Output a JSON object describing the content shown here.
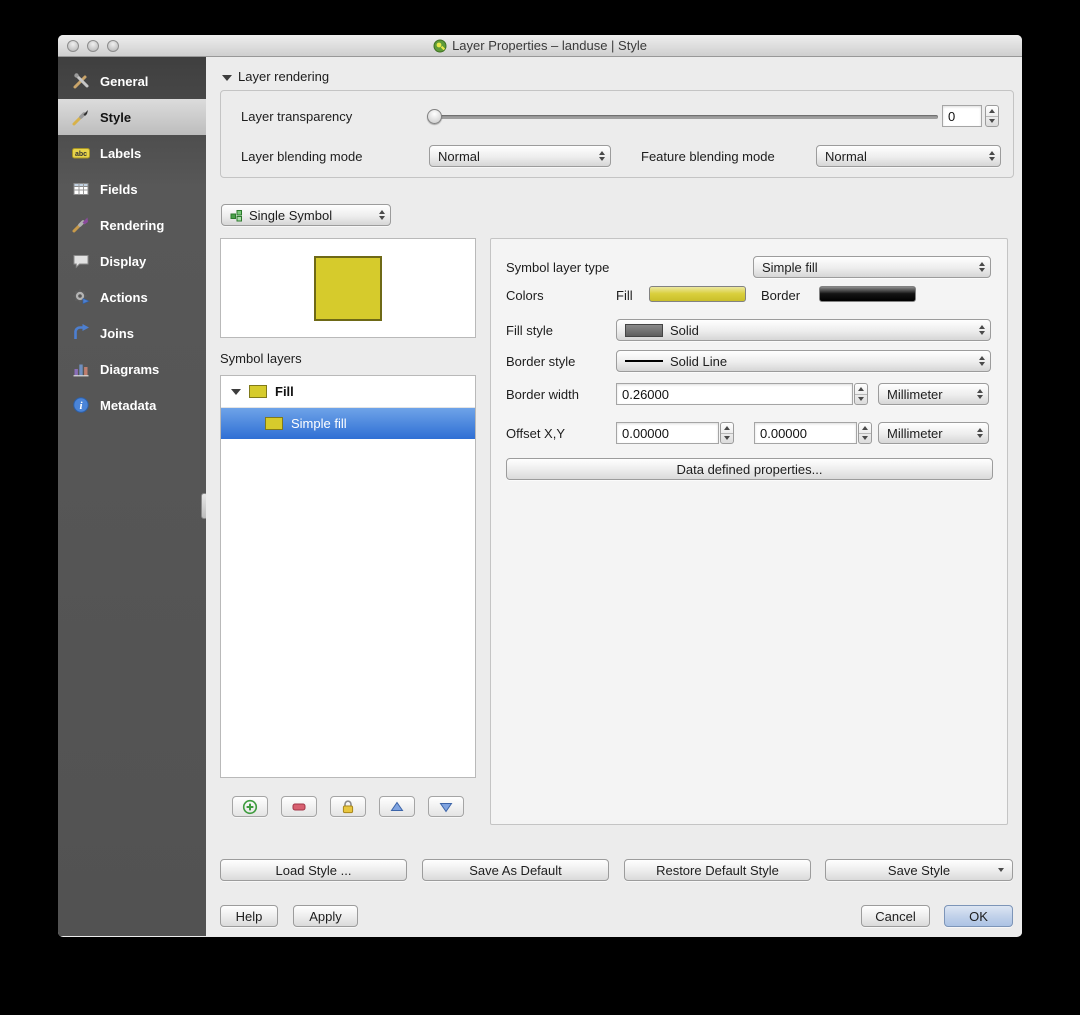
{
  "window": {
    "title": "Layer Properties – landuse | Style"
  },
  "sidebar": {
    "items": [
      {
        "label": "General"
      },
      {
        "label": "Style"
      },
      {
        "label": "Labels"
      },
      {
        "label": "Fields"
      },
      {
        "label": "Rendering"
      },
      {
        "label": "Display"
      },
      {
        "label": "Actions"
      },
      {
        "label": "Joins"
      },
      {
        "label": "Diagrams"
      },
      {
        "label": "Metadata"
      }
    ]
  },
  "layer_rendering": {
    "title": "Layer rendering",
    "transparency_label": "Layer transparency",
    "transparency_value": "0",
    "blending_label": "Layer blending mode",
    "blending_value": "Normal",
    "feature_blending_label": "Feature blending mode",
    "feature_blending_value": "Normal"
  },
  "symbol": {
    "selector_value": "Single Symbol",
    "symbol_layers_label": "Symbol layers",
    "tree": [
      {
        "label": "Fill"
      },
      {
        "label": "Simple fill"
      }
    ]
  },
  "properties": {
    "symbol_layer_type_label": "Symbol layer type",
    "symbol_layer_type_value": "Simple fill",
    "colors_label": "Colors",
    "fill_label": "Fill",
    "border_label": "Border",
    "fill_style_label": "Fill style",
    "fill_style_value": "Solid",
    "border_style_label": "Border style",
    "border_style_value": "Solid Line",
    "border_width_label": "Border width",
    "border_width_value": "0.26000",
    "border_width_unit": "Millimeter",
    "offset_label": "Offset X,Y",
    "offset_x_value": "0.00000",
    "offset_y_value": "0.00000",
    "offset_unit": "Millimeter",
    "data_defined_button": "Data defined properties..."
  },
  "style_buttons": {
    "load": "Load Style ...",
    "save_default": "Save As Default",
    "restore_default": "Restore Default Style",
    "save_style": "Save Style"
  },
  "footer": {
    "help": "Help",
    "apply": "Apply",
    "cancel": "Cancel",
    "ok": "OK"
  },
  "colors": {
    "fill": "#d6cb2c",
    "fill_border": "#6e6916",
    "border": "#000000",
    "selection": "#2f6fd4"
  }
}
